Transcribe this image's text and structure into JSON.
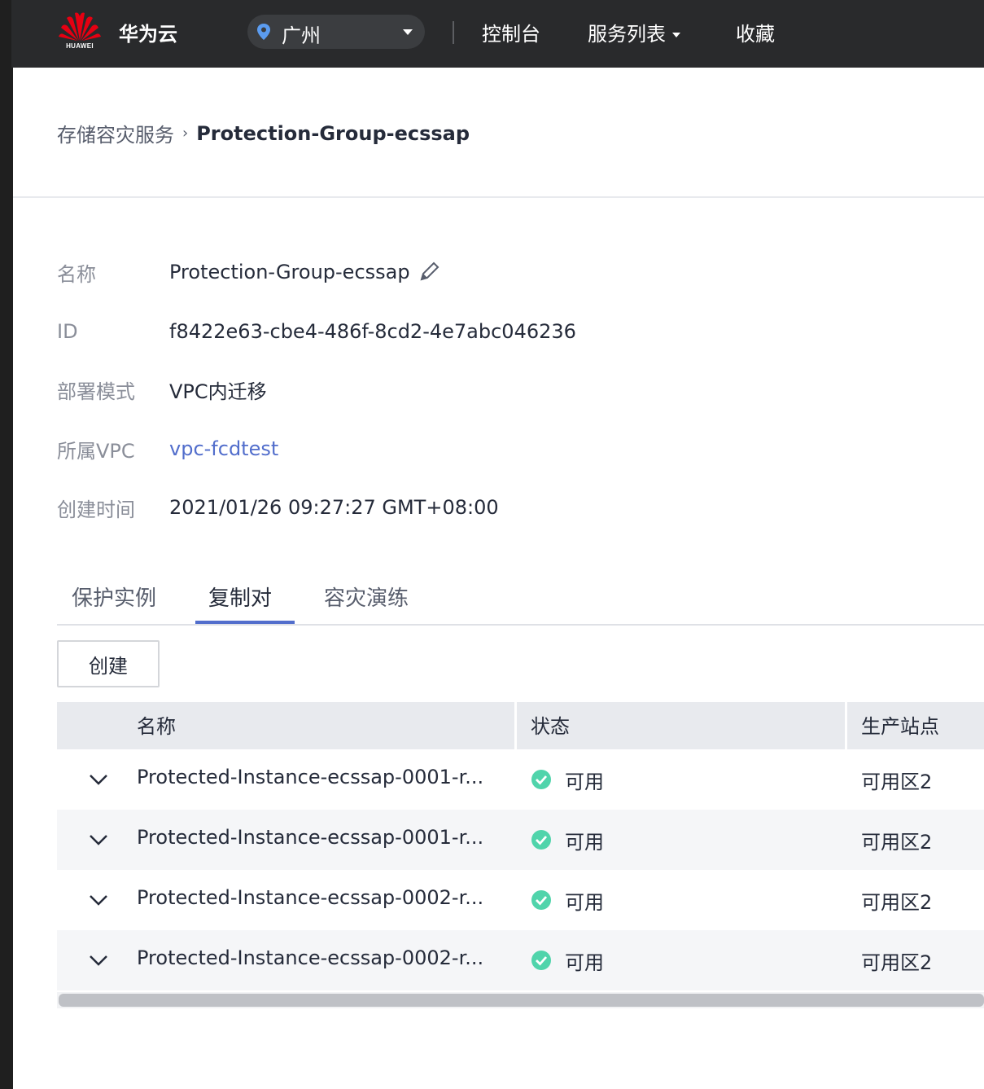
{
  "header": {
    "logo_text": "HUAWEI",
    "brand": "华为云",
    "region": "广州",
    "nav": {
      "console": "控制台",
      "services": "服务列表",
      "favorites": "收藏"
    }
  },
  "breadcrumb": {
    "parent": "存储容灾服务",
    "separator": "›",
    "current": "Protection-Group-ecssap"
  },
  "details": {
    "name_label": "名称",
    "name_value": "Protection-Group-ecssap",
    "id_label": "ID",
    "id_value": "f8422e63-cbe4-486f-8cd2-4e7abc046236",
    "mode_label": "部署模式",
    "mode_value": "VPC内迁移",
    "vpc_label": "所属VPC",
    "vpc_value": "vpc-fcdtest",
    "created_label": "创建时间",
    "created_value": "2021/01/26 09:27:27 GMT+08:00"
  },
  "tabs": [
    "保护实例",
    "复制对",
    "容灾演练"
  ],
  "active_tab": "复制对",
  "create_label": "创建",
  "table": {
    "columns": [
      "名称",
      "状态",
      "生产站点"
    ],
    "rows": [
      {
        "name": "Protected-Instance-ecssap-0001-r...",
        "status": "可用",
        "site": "可用区2"
      },
      {
        "name": "Protected-Instance-ecssap-0001-r...",
        "status": "可用",
        "site": "可用区2"
      },
      {
        "name": "Protected-Instance-ecssap-0002-r...",
        "status": "可用",
        "site": "可用区2"
      },
      {
        "name": "Protected-Instance-ecssap-0002-r...",
        "status": "可用",
        "site": "可用区2"
      }
    ]
  },
  "colors": {
    "topbar": "#292a2c",
    "accent": "#526ecc",
    "status_ok": "#50d4ab",
    "huawei_red": "#e60012"
  },
  "icons": {
    "location": "location-pin-icon",
    "edit": "pencil-icon",
    "expand": "chevron-down-icon",
    "status": "check-circle-icon"
  }
}
